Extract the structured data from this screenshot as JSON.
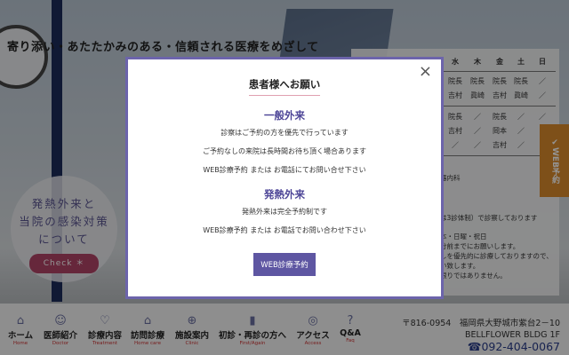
{
  "hero": {
    "tagline": "寄り添い・あたたかみのある・信頼される医療をめざして",
    "fever_circle": [
      "発熱外来と",
      "当院の感染対策",
      "について"
    ],
    "check_label": "Check ＊"
  },
  "schedule": {
    "days": [
      "水",
      "木",
      "金",
      "土",
      "日"
    ],
    "rows": [
      [
        "院長",
        "院長",
        "院長",
        "院長",
        "／"
      ],
      [
        "吉村",
        "眞崎",
        "吉村",
        "眞崎",
        "／"
      ],
      [
        "院長",
        "／",
        "院長",
        "／",
        "／"
      ],
      [
        "吉村",
        "／",
        "岡本",
        "／",
        ""
      ],
      [
        "／",
        "／",
        "吉村",
        "／",
        ""
      ]
    ],
    "notes": [
      "器内科",
      "は3診体制）で診察しております",
      "本・日曜・祝日",
      "分前までにお願いします。",
      "しを優先的に診療しておりますので、",
      "い致します。",
      "限りではありません。"
    ]
  },
  "web_tab": "✔WEB予約",
  "footer": {
    "nav": [
      {
        "label": "ホーム",
        "sub": "Home",
        "icon": "⌂"
      },
      {
        "label": "医師紹介",
        "sub": "Doctor",
        "icon": "☺"
      },
      {
        "label": "診療内容",
        "sub": "Treatment",
        "icon": "♡"
      },
      {
        "label": "訪問診療",
        "sub": "Home care",
        "icon": "⌂"
      },
      {
        "label": "施設案内",
        "sub": "Clinic",
        "icon": "⊕"
      },
      {
        "label": "初診・再診の方へ",
        "sub": "First/Again",
        "icon": "▮"
      },
      {
        "label": "アクセス",
        "sub": "Access",
        "icon": "◎"
      },
      {
        "label": "Q&A",
        "sub": "Faq",
        "icon": "?"
      }
    ],
    "postal": "〒816-0954",
    "address": "福岡県大野城市紫台2－10",
    "building": "BELLFLOWER BLDG 1F",
    "phone": "092-404-0067"
  },
  "modal": {
    "title": "患者様へお願い",
    "section1": "一般外来",
    "s1_lines": [
      "診察はご予約の方を優先で行っています",
      "ご予約なしの来院は長時間お待ち頂く場合あります",
      "WEB診療予約 または お電話にてお問い合せ下さい"
    ],
    "section2": "発熱外来",
    "s2_lines": [
      "発熱外来は完全予約制です",
      "WEB診療予約 または お電話でお問い合わせ下さい"
    ],
    "button": "WEB診療予約",
    "close": "×"
  }
}
